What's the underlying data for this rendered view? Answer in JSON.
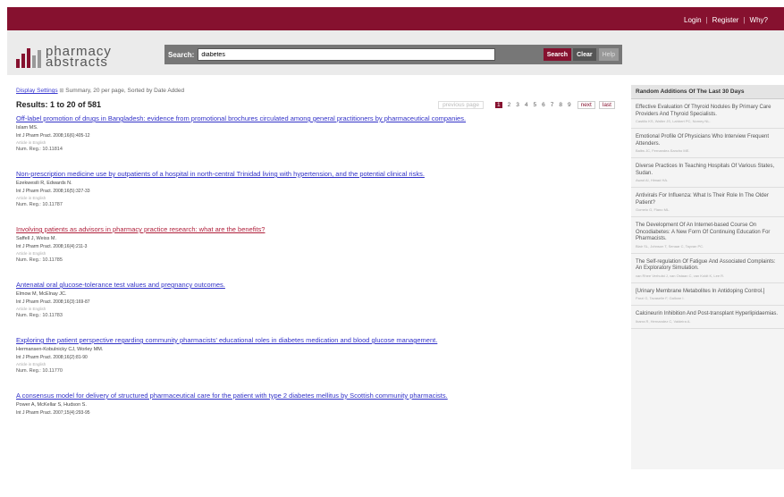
{
  "top_nav": {
    "login": "Login",
    "register": "Register",
    "why": "Why?",
    "sep": "|"
  },
  "brand": {
    "line1": "pharmacy",
    "line2": "abstracts"
  },
  "search": {
    "label": "Search:",
    "value": "diabetes",
    "search_btn": "Search",
    "clear_btn": "Clear",
    "help_btn": "Help"
  },
  "display": {
    "link": "Display Settings",
    "summary": "Summary, 20 per page, Sorted by Date Added"
  },
  "results_heading": "Results: 1 to 20 of 581",
  "pager": {
    "prev": "previous page",
    "pages": [
      "1",
      "2",
      "3",
      "4",
      "5",
      "6",
      "7",
      "8",
      "9"
    ],
    "next": "next",
    "last": "last"
  },
  "results": [
    {
      "title": "Off-label promotion of drugs in Bangladesh: evidence from promotional brochures circulated among general practitioners by pharmaceutical companies.",
      "authors": "Islam MS.",
      "citation": "Int J Pharm Pract. 2008;16(6):405-12",
      "lang": "Article in English",
      "num": "Num. Reg.: 10.11814",
      "visited": false
    },
    {
      "title": "Non-prescription medicine use by outpatients of a hospital in north-central Trinidad living with hypertension, and the potential clinical risks.",
      "authors": "Ezekwesili R, Edwards N.",
      "citation": "Int J Pharm Pract. 2008;16(5):327-33",
      "lang": "Article in English",
      "num": "Num. Reg.: 10.11787",
      "visited": false
    },
    {
      "title": "Involving patients as advisors in pharmacy practice research: what are the benefits?",
      "authors": "Saffell J, Weiss M.",
      "citation": "Int J Pharm Pract. 2008;16(4):211-3",
      "lang": "Article in English",
      "num": "Num. Reg.: 10.11785",
      "visited": true
    },
    {
      "title": "Antenatal oral glucose-tolerance test values and pregnancy outcomes.",
      "authors": "Elmow M, McElnay JC.",
      "citation": "Int J Pharm Pract. 2008;16(3):169-87",
      "lang": "Article in English",
      "num": "Num. Reg.: 10.11783",
      "visited": false
    },
    {
      "title": "Exploring the patient perspective regarding community pharmacists' educational roles in diabetes medication and blood glucose management.",
      "authors": "Hermansen-Kobulnicky CJ, Worley MM.",
      "citation": "Int J Pharm Pract. 2008;16(2):81-90",
      "lang": "Article in English",
      "num": "Num. Reg.: 10.11770",
      "visited": false
    },
    {
      "title": "A consensus model for delivery of structured pharmaceutical care for the patient with type 2 diabetes mellitus by Scottish community pharmacists.",
      "authors": "Power A, McKellar S, Hudson S.",
      "citation": "Int J Pharm Pract. 2007;15(4):293-95",
      "lang": "",
      "num": "",
      "visited": false
    }
  ],
  "sidebar": {
    "heading": "Random Additions Of The Last 30 Days",
    "items": [
      {
        "title": "Effective Evaluation Of Thyroid Nodules By Primary Care Providers And Thyroid Specialists.",
        "authors": "Castillo KS, Walter JS, Lahbert PC, Nomey NL."
      },
      {
        "title": "Emotional Profile Of Physicians Who Interview Frequent Attenders.",
        "authors": "Balbs JC, Fernandez-Sancho ME."
      },
      {
        "title": "Diverse Practices In Teaching Hospitals Of Various States, Sudan.",
        "authors": "Awad AI, Himad HA."
      },
      {
        "title": "Antivirals For Influenza: What Is Their Role In The Older Patient?",
        "authors": "Gomelo G, Flano ML."
      },
      {
        "title": "The Development Of An Internet-based Course On Oncodiabetes: A New Form Of Continuing Education For Pharmacists.",
        "authors": "Blair SL, Johnson T, Senaar C, Tayvan PC."
      },
      {
        "title": "The Self-regulation Of Fatigue And Associated Complaints: An Exploratory Simulation.",
        "authors": "van Rhee Verhulst J, van Ostaan C, van Koldt K, Lee R."
      },
      {
        "title": "[Urinary Membrane Metabolites In Antidoping Control.]",
        "authors": "Parzi G, Tavaselle F, Gallone I."
      },
      {
        "title": "Calcineurin Inhibition And Post-transplant Hyperlipidaemias.",
        "authors": "Ibarra R, Hernandez C, Valdeira A."
      }
    ]
  },
  "colors": {
    "brand": "#86112f",
    "link": "#3232c8",
    "visited": "#b0213c",
    "header_bg": "#ebebeb"
  }
}
